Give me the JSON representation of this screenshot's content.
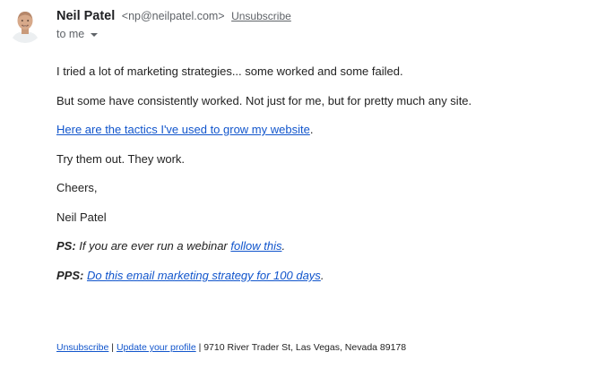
{
  "sender": {
    "name": "Neil Patel",
    "email": "<np@neilpatel.com>",
    "unsubscribe_label": "Unsubscribe"
  },
  "recipient": {
    "label": "to me"
  },
  "body": {
    "p1": "I tried a lot of marketing strategies... some worked and some failed.",
    "p2": "But some have consistently worked. Not just for me, but for pretty much any site.",
    "p3_link": "Here are the tactics I've used to grow my website",
    "p3_end": ".",
    "p4": "Try them out. They work.",
    "p5": "Cheers,",
    "p6": "Neil Patel",
    "ps_label": "PS:",
    "ps_text": " If you are ever run a webinar ",
    "ps_link": "follow this",
    "ps_end": ".",
    "pps_label": "PPS:",
    "pps_space": " ",
    "pps_link": "Do this email marketing strategy for 100 days",
    "pps_end": "."
  },
  "footer": {
    "unsubscribe": "Unsubscribe",
    "sep1": " | ",
    "update_profile": "Update your profile",
    "sep2": " | ",
    "address": "9710 River Trader St, Las Vegas, Nevada 89178"
  },
  "colors": {
    "link": "#1155cc",
    "meta_gray": "#5f6368",
    "text": "#222222"
  },
  "icons": {
    "avatar": "sender-avatar",
    "dropdown": "caret-down-icon"
  }
}
